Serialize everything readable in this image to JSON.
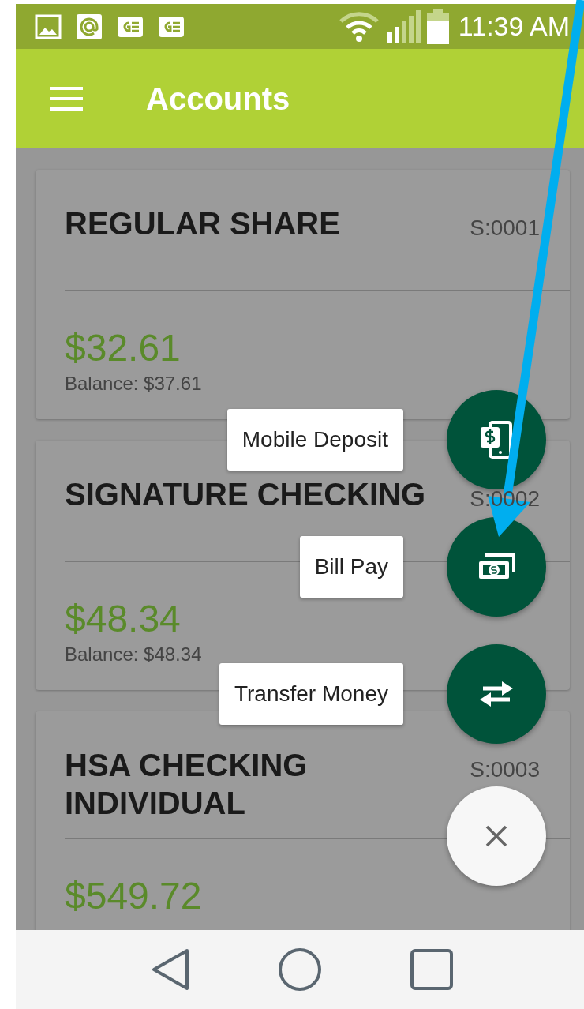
{
  "status_bar": {
    "time": "11:39 AM"
  },
  "app_bar": {
    "title": "Accounts"
  },
  "accounts": [
    {
      "name": "REGULAR SHARE",
      "number": "S:0001",
      "amount": "$32.61",
      "balance": "Balance: $37.61"
    },
    {
      "name": "SIGNATURE CHECKING",
      "number": "S:0002",
      "amount": "$48.34",
      "balance": "Balance: $48.34"
    },
    {
      "name": "HSA CHECKING INDIVIDUAL",
      "number": "S:0003",
      "amount": "$549.72"
    }
  ],
  "fab_menu": {
    "expanded": true,
    "actions": [
      {
        "kind": "deposit",
        "label": "Mobile Deposit"
      },
      {
        "kind": "bill",
        "label": "Bill Pay"
      },
      {
        "kind": "transfer",
        "label": "Transfer Money"
      }
    ]
  }
}
